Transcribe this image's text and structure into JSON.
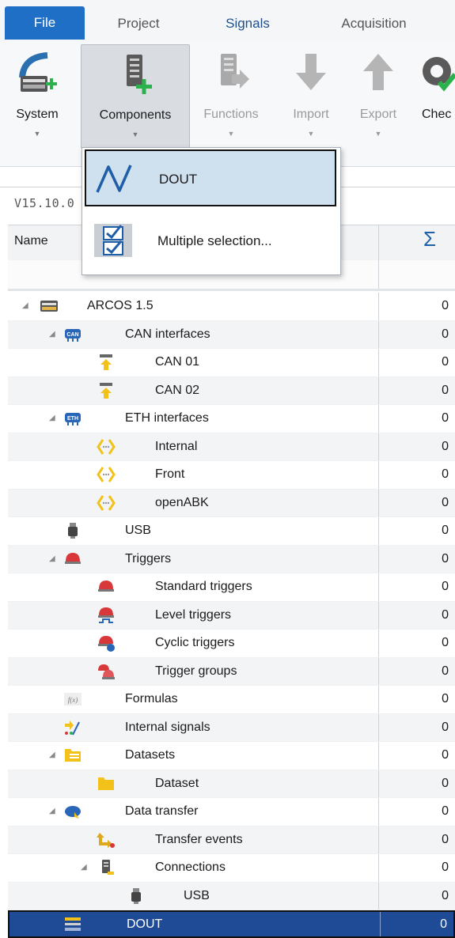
{
  "menu": {
    "file": "File",
    "project": "Project",
    "signals": "Signals",
    "acquisition": "Acquisition"
  },
  "ribbon": {
    "system": "System",
    "components": "Components",
    "functions": "Functions",
    "import": "Import",
    "export": "Export",
    "check": "Chec"
  },
  "dropdown": {
    "items": [
      {
        "label": "DOUT",
        "icon": "waveform-icon"
      },
      {
        "label": "Multiple selection...",
        "icon": "checklist-icon"
      }
    ]
  },
  "panel": {
    "version": "V15.10.0",
    "col_name": "Name",
    "col_sum": "Σ"
  },
  "tree": {
    "rows": [
      {
        "label": "ARCOS 1.5",
        "value": "0"
      },
      {
        "label": "CAN interfaces",
        "value": "0"
      },
      {
        "label": "CAN 01",
        "value": "0"
      },
      {
        "label": "CAN 02",
        "value": "0"
      },
      {
        "label": "ETH interfaces",
        "value": "0"
      },
      {
        "label": "Internal",
        "value": "0"
      },
      {
        "label": "Front",
        "value": "0"
      },
      {
        "label": "openABK",
        "value": "0"
      },
      {
        "label": "USB",
        "value": "0"
      },
      {
        "label": "Triggers",
        "value": "0"
      },
      {
        "label": "Standard triggers",
        "value": "0"
      },
      {
        "label": "Level triggers",
        "value": "0"
      },
      {
        "label": "Cyclic triggers",
        "value": "0"
      },
      {
        "label": "Trigger groups",
        "value": "0"
      },
      {
        "label": "Formulas",
        "value": "0"
      },
      {
        "label": "Internal signals",
        "value": "0"
      },
      {
        "label": "Datasets",
        "value": "0"
      },
      {
        "label": "Dataset",
        "value": "0"
      },
      {
        "label": "Data transfer",
        "value": "0"
      },
      {
        "label": "Transfer events",
        "value": "0"
      },
      {
        "label": "Connections",
        "value": "0"
      },
      {
        "label": "USB",
        "value": "0"
      },
      {
        "label": "DOUT",
        "value": "0"
      }
    ]
  },
  "colors": {
    "accent": "#1f6fc6",
    "selection": "#1f4b96",
    "highlight": "#cfe0ef",
    "icon_yellow": "#f2c21b",
    "icon_red": "#d9383a"
  }
}
